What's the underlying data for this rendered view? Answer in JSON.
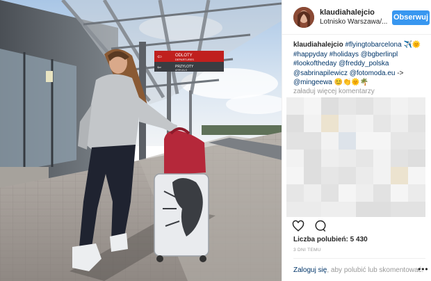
{
  "header": {
    "username": "klaudiahalejcio",
    "location": "Lotnisko Warszawa/...",
    "follow_label": "Obserwuj"
  },
  "caption": {
    "username": "klaudiahalejcio",
    "tags": [
      "#flyingtobarcelona",
      "#happyday",
      "#holidays",
      "@bgberlinpl",
      "#lookoftheday",
      "@freddy_polska",
      "@sabrinapilewicz",
      "@fotomoda.eu",
      "->",
      "@mingeewa"
    ]
  },
  "comments": {
    "load_more": "załaduj więcej komentarzy"
  },
  "sign": {
    "departures": "ODLOTY",
    "departures_en": "DEPARTURES",
    "arrivals": "PRZYLOTY",
    "arrivals_en": "ARRIVALS"
  },
  "actions": {
    "like_icon": "heart-icon",
    "comment_icon": "comment-icon"
  },
  "likes": "Liczba polubień: 5 430",
  "time": "3 DNI TEMU",
  "footer": {
    "login": "Zaloguj się",
    "rest": ", aby polubić lub skomentować.",
    "options_icon": "more-options-icon"
  },
  "colors": {
    "accent": "#3897f0",
    "link": "#003569",
    "muted": "#999999",
    "sign_red": "#c0201e"
  }
}
